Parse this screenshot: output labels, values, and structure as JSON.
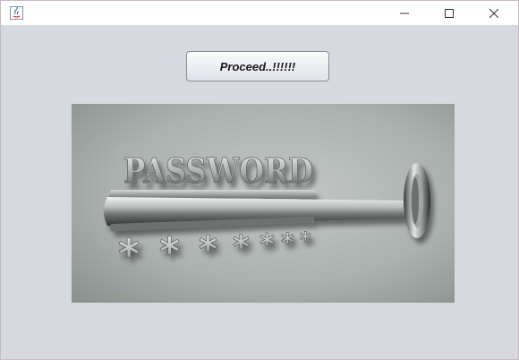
{
  "window": {
    "controls": {
      "minimize_icon": "minimize-icon",
      "maximize_icon": "maximize-icon",
      "close_icon": "close-icon"
    }
  },
  "main": {
    "proceed_label": "Proceed..!!!!!!"
  },
  "image": {
    "word": "PASSWORD",
    "symbols": [
      "*",
      "*",
      "*",
      "*",
      "*",
      "*",
      "*"
    ]
  },
  "colors": {
    "background": "#d6d9e0",
    "titlebar": "#ffffff",
    "picture_bg": "#a9b0ad"
  }
}
